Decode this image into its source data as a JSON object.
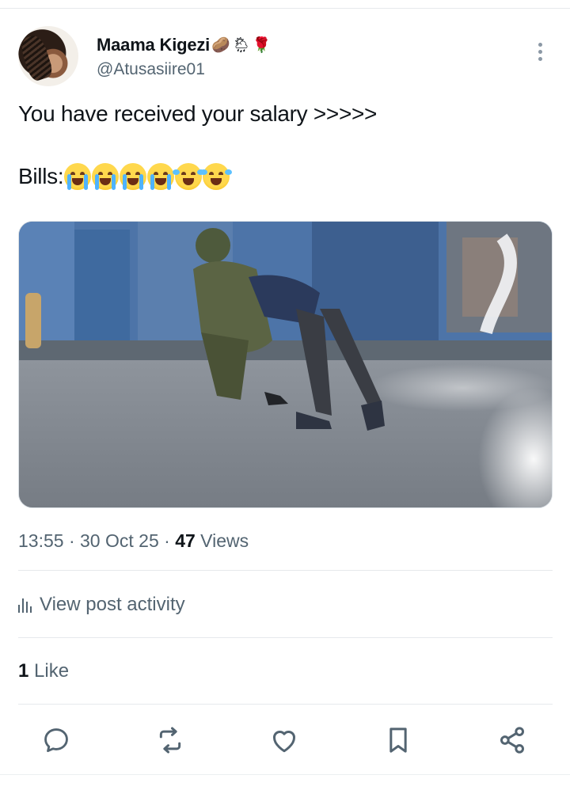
{
  "author": {
    "display_name": "Maama Kigezi",
    "name_emojis": [
      "🥔",
      "🌦",
      "🌹"
    ],
    "handle": "@Atusasiire01"
  },
  "post": {
    "line1": "You have received your salary >>>>>",
    "line2_prefix": "Bills:",
    "line2_emojis": [
      "😭",
      "😭",
      "😭",
      "😭",
      "😂",
      "😂"
    ]
  },
  "meta": {
    "time": "13:55",
    "sep1": " · ",
    "date": "30 Oct 25",
    "sep2": " · ",
    "views_count": "47",
    "views_label": " Views"
  },
  "activity": {
    "label": "View post activity"
  },
  "likes": {
    "count": "1",
    "label": " Like"
  },
  "actions": {
    "icons": [
      "reply-icon",
      "repost-icon",
      "like-icon",
      "bookmark-icon",
      "share-icon"
    ]
  },
  "colors": {
    "text": "#0f1419",
    "secondary": "#536471",
    "divider": "#e6e9ec",
    "icon": "#536471"
  }
}
